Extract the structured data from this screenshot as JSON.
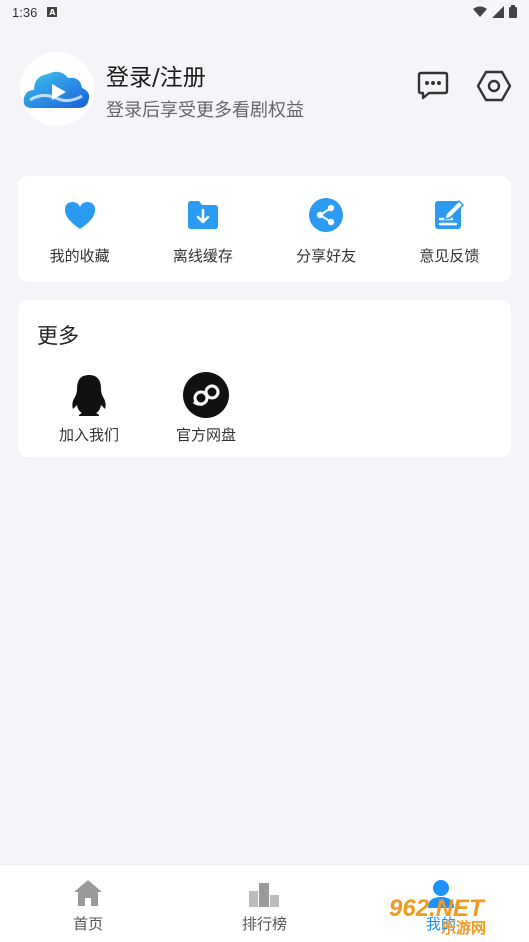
{
  "status_bar": {
    "time": "1:36",
    "notification_glyph": "A"
  },
  "profile": {
    "title": "登录/注册",
    "subtitle": "登录后享受更多看剧权益"
  },
  "quick_actions": [
    {
      "label": "我的收藏",
      "icon": "heart-icon"
    },
    {
      "label": "离线缓存",
      "icon": "download-folder-icon"
    },
    {
      "label": "分享好友",
      "icon": "share-icon"
    },
    {
      "label": "意见反馈",
      "icon": "feedback-icon"
    }
  ],
  "more": {
    "title": "更多",
    "items": [
      {
        "label": "加入我们",
        "icon": "qq-penguin-icon"
      },
      {
        "label": "官方网盘",
        "icon": "cloud-disk-icon"
      }
    ]
  },
  "tabs": [
    {
      "label": "首页",
      "icon": "home-icon"
    },
    {
      "label": "排行榜",
      "icon": "ranking-icon"
    },
    {
      "label": "我的",
      "icon": "profile-icon"
    }
  ],
  "watermark": {
    "text": "962.NET",
    "subtext": "乐游网"
  },
  "colors": {
    "accent": "#1e90ff",
    "background": "#f4f5f8"
  }
}
